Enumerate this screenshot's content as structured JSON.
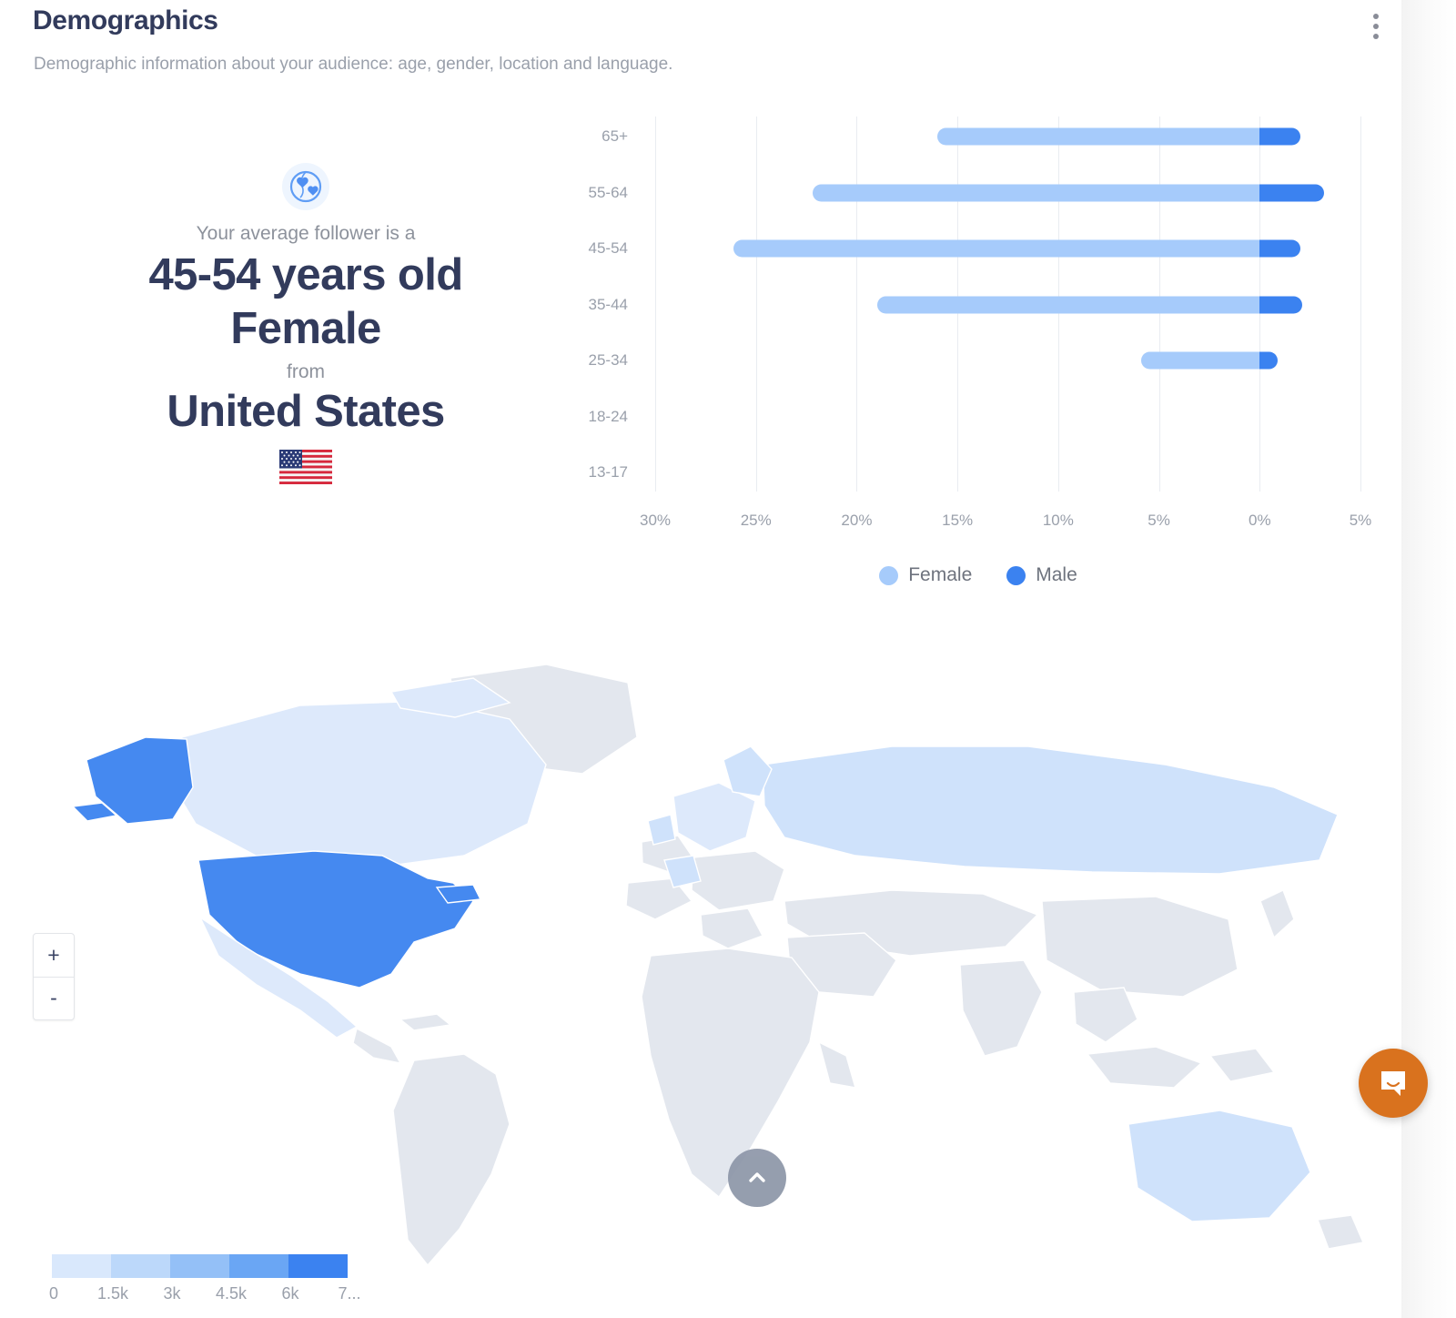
{
  "header": {
    "title": "Demographics",
    "subtitle": "Demographic information about your audience: age, gender, location and language.",
    "menu_icon": "kebab-menu-icon"
  },
  "summary": {
    "icon": "globe-heart-icon",
    "lead": "Your average follower is a",
    "age": "45-54 years old",
    "gender": "Female",
    "connector": "from",
    "country": "United States",
    "flag": "us-flag-icon"
  },
  "legend": {
    "female_label": "Female",
    "male_label": "Male",
    "female_color": "#a6cbfb",
    "male_color": "#3b82f0"
  },
  "chart_data": {
    "type": "bar",
    "orientation": "horizontal",
    "layout": "diverging-population-pyramid",
    "title": "",
    "xlabel": "",
    "ylabel": "",
    "categories": [
      "65+",
      "55-64",
      "45-54",
      "35-44",
      "25-34",
      "18-24",
      "13-17"
    ],
    "x_tick_labels": [
      "30%",
      "25%",
      "20%",
      "15%",
      "10%",
      "5%",
      "0%",
      "5%"
    ],
    "x_tick_values": [
      30,
      25,
      20,
      15,
      10,
      5,
      0,
      5
    ],
    "axis_min_female": 30,
    "axis_max_male": 5,
    "grid": true,
    "legend_position": "bottom-center",
    "series": [
      {
        "name": "Female",
        "color": "#a6cbfb",
        "values": [
          16.0,
          22.2,
          26.1,
          19.0,
          5.9,
          0,
          0
        ]
      },
      {
        "name": "Male",
        "color": "#3b82f0",
        "values": [
          2.0,
          3.2,
          2.0,
          2.1,
          0.9,
          0,
          0
        ]
      }
    ]
  },
  "map": {
    "zoom_in_label": "+",
    "zoom_out_label": "-",
    "scale_labels": [
      "0",
      "1.5k",
      "3k",
      "4.5k",
      "6k",
      "7..."
    ],
    "swatch_colors": [
      "#d9e8fc",
      "#bcd8fa",
      "#94c0f7",
      "#6aa6f4",
      "#3b82f0"
    ],
    "highlight_color": "#4589f0",
    "countries": [
      {
        "name": "United States",
        "value": "7k+",
        "color": "#4589f0"
      },
      {
        "name": "Alaska",
        "value": "7k+",
        "color": "#4589f0"
      },
      {
        "name": "Canada",
        "value": "low",
        "color": "#d9e8fc"
      }
    ]
  },
  "floating": {
    "scroll_top_icon": "chevron-up-icon",
    "chat_icon": "intercom-chat-icon",
    "chat_color": "#d9721e"
  }
}
